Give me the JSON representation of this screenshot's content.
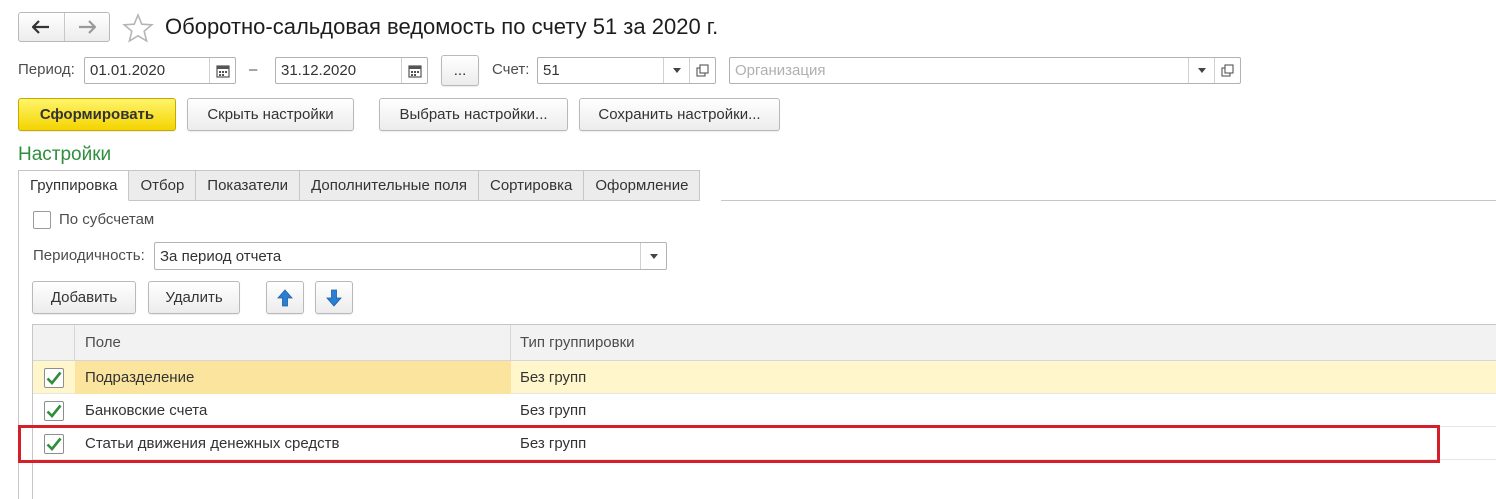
{
  "window": {
    "title": "Оборотно-сальдовая ведомость по счету 51 за 2020 г."
  },
  "params": {
    "period_label": "Период:",
    "date_from": "01.01.2020",
    "dash": "–",
    "date_to": "31.12.2020",
    "more_label": "...",
    "account_label": "Счет:",
    "account_value": "51",
    "org_placeholder": "Организация"
  },
  "toolbar": {
    "generate": "Сформировать",
    "hide_settings": "Скрыть настройки",
    "choose_settings": "Выбрать настройки...",
    "save_settings": "Сохранить настройки..."
  },
  "settings": {
    "title": "Настройки",
    "tabs": [
      {
        "label": "Группировка",
        "active": true
      },
      {
        "label": "Отбор",
        "active": false
      },
      {
        "label": "Показатели",
        "active": false
      },
      {
        "label": "Дополнительные поля",
        "active": false
      },
      {
        "label": "Сортировка",
        "active": false
      },
      {
        "label": "Оформление",
        "active": false
      }
    ],
    "by_subaccounts_label": "По субсчетам",
    "by_subaccounts_checked": false,
    "periodicity_label": "Периодичность:",
    "periodicity_value": "За период отчета",
    "add_button": "Добавить",
    "delete_button": "Удалить",
    "grid": {
      "columns": [
        "Поле",
        "Тип группировки"
      ],
      "rows": [
        {
          "checked": true,
          "field": "Подразделение",
          "type": "Без групп",
          "selected": true
        },
        {
          "checked": true,
          "field": "Банковские счета",
          "type": "Без групп",
          "selected": false
        },
        {
          "checked": true,
          "field": "Статьи движения денежных средств",
          "type": "Без групп",
          "selected": false,
          "highlighted": true
        }
      ]
    }
  },
  "colors": {
    "accent_green": "#2f8e3c",
    "primary_yellow": "#f3d400",
    "highlight_red": "#d5202a",
    "check_green": "#2f8e3c",
    "arrow_blue": "#2b7fd3"
  }
}
